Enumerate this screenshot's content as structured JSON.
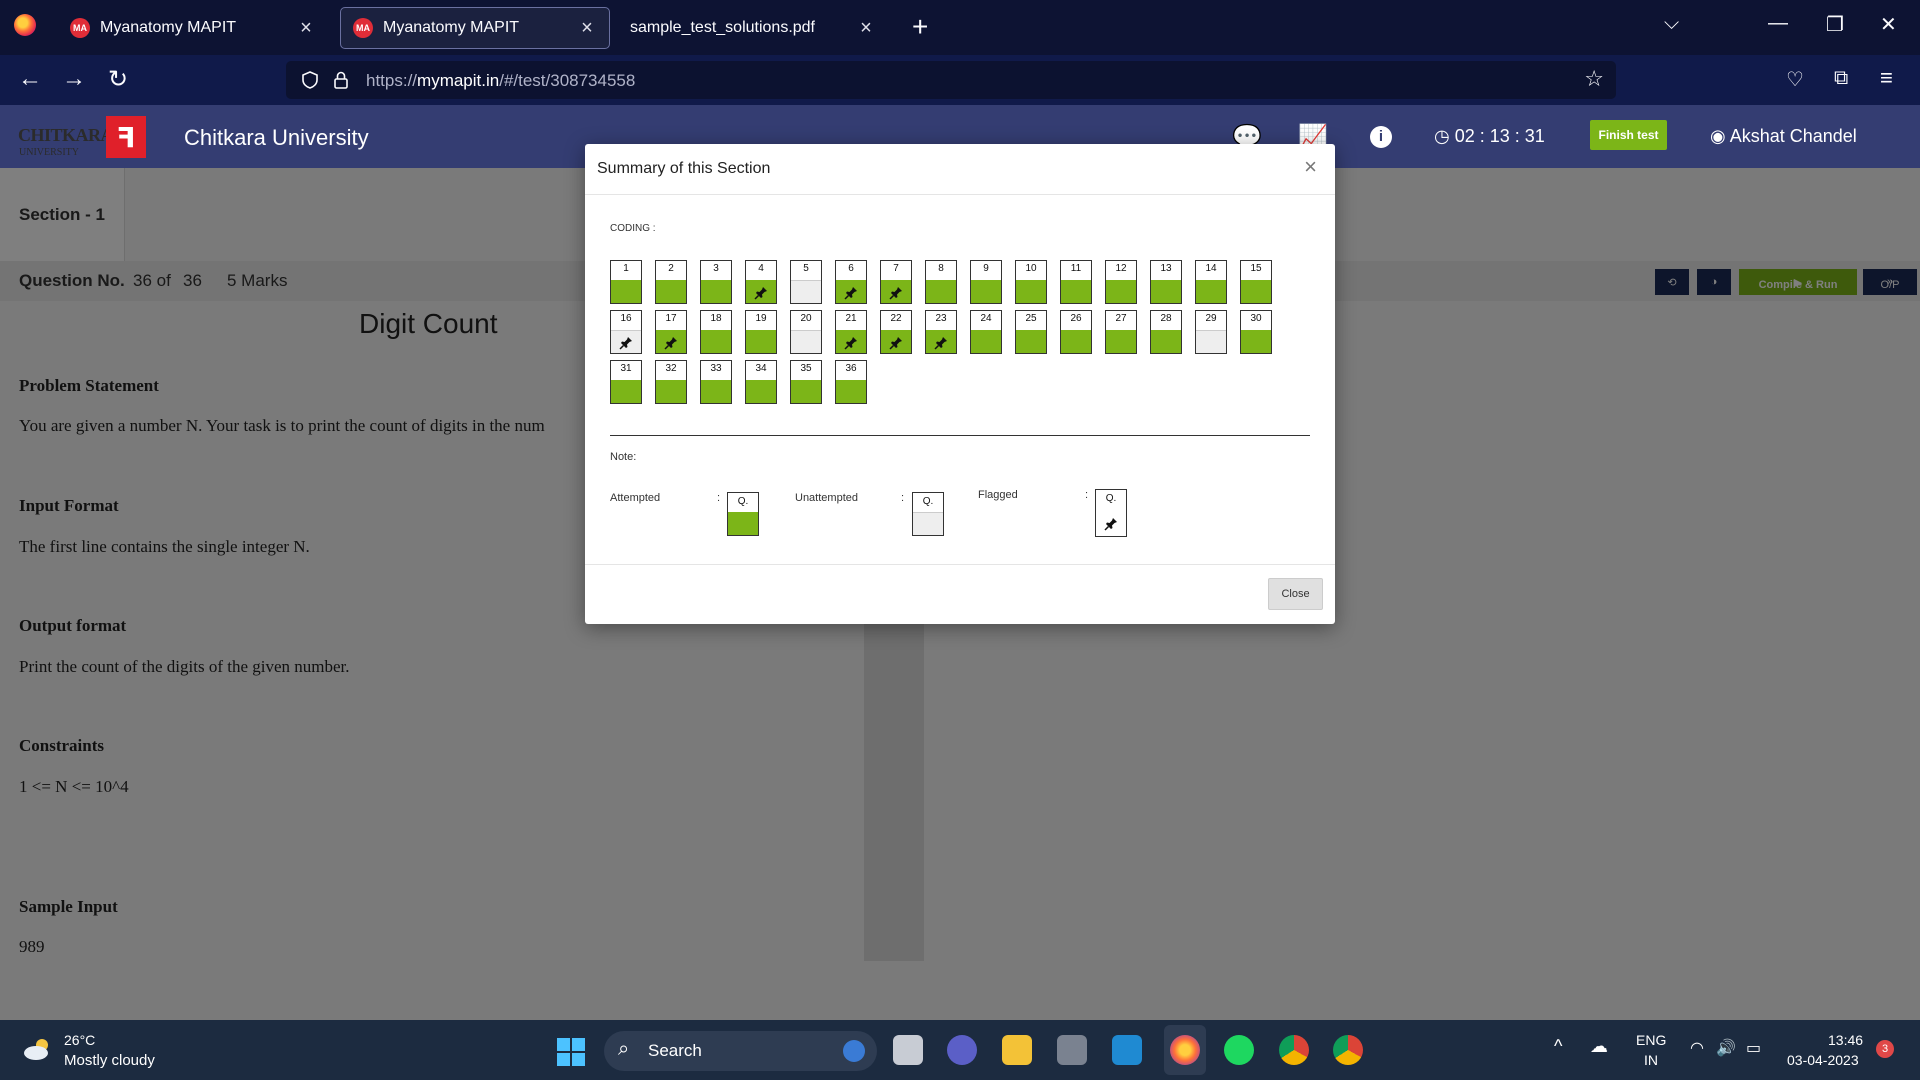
{
  "browser": {
    "tabs": [
      {
        "title": "Myanatomy MAPIT",
        "favicon": "MA",
        "active": false
      },
      {
        "title": "Myanatomy MAPIT",
        "favicon": "MA",
        "active": true
      },
      {
        "title": "sample_test_solutions.pdf",
        "favicon": "",
        "active": false
      }
    ],
    "url_prefix": "https://",
    "url_domain": "mymapit.in",
    "url_path": "/#/test/308734558"
  },
  "header": {
    "logo_text": "CHITKARA",
    "logo_sub": "UNIVERSITY",
    "university": "Chitkara University",
    "timer": "02 : 13 : 31",
    "finish_label": "Finish test",
    "user": "Akshat Chandel"
  },
  "test": {
    "section": "Section - 1",
    "question_label": "Question No.",
    "question_current": "36 of",
    "question_total": "36",
    "marks": "5 Marks",
    "compile_label": "Compile & Run",
    "op_label": "O/P"
  },
  "problem": {
    "title": "Digit Count",
    "statement_heading": "Problem Statement",
    "statement": "You are given a number N. Your task is to print the count of digits in the num",
    "input_heading": "Input Format",
    "input_text": "The first line contains the single integer N.",
    "output_heading": "Output format",
    "output_text": "Print the count of the digits of the given number.",
    "constraints_heading": "Constraints",
    "constraints_text": "1 <= N <= 10^4",
    "sample_heading": "Sample Input",
    "sample_text": "989"
  },
  "modal": {
    "title": "Summary of this Section",
    "category": "CODING :",
    "note": "Note:",
    "legend": [
      {
        "label": "Attempted",
        "box": "Q.",
        "state": "attempted"
      },
      {
        "label": "Unattempted",
        "box": "Q.",
        "state": "unattempted"
      },
      {
        "label": "Flagged",
        "box": "Q.",
        "state": "flagged"
      }
    ],
    "close_label": "Close",
    "questions": [
      {
        "n": "1",
        "state": "attempted",
        "flag": false
      },
      {
        "n": "2",
        "state": "attempted",
        "flag": false
      },
      {
        "n": "3",
        "state": "attempted",
        "flag": false
      },
      {
        "n": "4",
        "state": "attempted",
        "flag": true
      },
      {
        "n": "5",
        "state": "unattempted",
        "flag": false
      },
      {
        "n": "6",
        "state": "attempted",
        "flag": true
      },
      {
        "n": "7",
        "state": "attempted",
        "flag": true
      },
      {
        "n": "8",
        "state": "attempted",
        "flag": false
      },
      {
        "n": "9",
        "state": "attempted",
        "flag": false
      },
      {
        "n": "10",
        "state": "attempted",
        "flag": false
      },
      {
        "n": "11",
        "state": "attempted",
        "flag": false
      },
      {
        "n": "12",
        "state": "attempted",
        "flag": false
      },
      {
        "n": "13",
        "state": "attempted",
        "flag": false
      },
      {
        "n": "14",
        "state": "attempted",
        "flag": false
      },
      {
        "n": "15",
        "state": "attempted",
        "flag": false
      },
      {
        "n": "16",
        "state": "unattempted",
        "flag": true
      },
      {
        "n": "17",
        "state": "attempted",
        "flag": true
      },
      {
        "n": "18",
        "state": "attempted",
        "flag": false
      },
      {
        "n": "19",
        "state": "attempted",
        "flag": false
      },
      {
        "n": "20",
        "state": "unattempted",
        "flag": false
      },
      {
        "n": "21",
        "state": "attempted",
        "flag": true
      },
      {
        "n": "22",
        "state": "attempted",
        "flag": true
      },
      {
        "n": "23",
        "state": "attempted",
        "flag": true
      },
      {
        "n": "24",
        "state": "attempted",
        "flag": false
      },
      {
        "n": "25",
        "state": "attempted",
        "flag": false
      },
      {
        "n": "26",
        "state": "attempted",
        "flag": false
      },
      {
        "n": "27",
        "state": "attempted",
        "flag": false
      },
      {
        "n": "28",
        "state": "attempted",
        "flag": false
      },
      {
        "n": "29",
        "state": "unattempted",
        "flag": false
      },
      {
        "n": "30",
        "state": "attempted",
        "flag": false
      },
      {
        "n": "31",
        "state": "attempted",
        "flag": false
      },
      {
        "n": "32",
        "state": "attempted",
        "flag": false
      },
      {
        "n": "33",
        "state": "attempted",
        "flag": false
      },
      {
        "n": "34",
        "state": "attempted",
        "flag": false
      },
      {
        "n": "35",
        "state": "attempted",
        "flag": false
      },
      {
        "n": "36",
        "state": "attempted",
        "flag": false
      }
    ]
  },
  "taskbar": {
    "temp": "26°C",
    "weather": "Mostly cloudy",
    "search": "Search",
    "lang": "ENG",
    "region": "IN",
    "time": "13:46",
    "date": "03-04-2023",
    "notifications": "3"
  },
  "colors": {
    "attempted": "#7cb518",
    "unattempted": "#eeeeee",
    "header": "#343d72",
    "tabbar": "#0d1333"
  }
}
